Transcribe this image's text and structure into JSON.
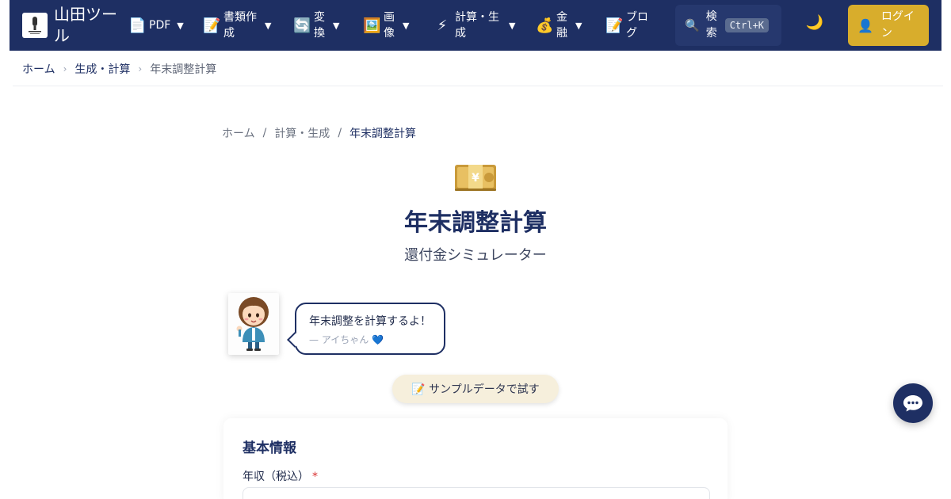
{
  "site": {
    "brand_name": "山田ツール"
  },
  "nav": {
    "items": [
      {
        "icon": "📄",
        "label": "PDF",
        "icon_name": "document-icon"
      },
      {
        "icon": "📝",
        "label": "書類作成",
        "icon_name": "memo-icon"
      },
      {
        "icon": "🔄",
        "label": "変換",
        "icon_name": "convert-icon"
      },
      {
        "icon": "🖼️",
        "label": "画像",
        "icon_name": "picture-icon"
      },
      {
        "icon": "⚡",
        "label": "計算・生成",
        "icon_name": "lightning-icon"
      },
      {
        "icon": "💰",
        "label": "金融",
        "icon_name": "money-bag-icon"
      },
      {
        "icon": "📝",
        "label": "ブログ",
        "icon_name": "memo-icon"
      }
    ],
    "search": {
      "icon": "🔍",
      "label": "検索",
      "shortcut": "Ctrl+K"
    },
    "theme_icon": "🌙",
    "login": {
      "icon": "👤",
      "label": "ログイン"
    }
  },
  "breadcrumb_top": {
    "home": "ホーム",
    "category": "生成・計算",
    "current": "年末調整計算"
  },
  "breadcrumb_inner": {
    "home": "ホーム",
    "category": "計算・生成",
    "current": "年末調整計算"
  },
  "hero": {
    "icon_name": "yen-banknote-icon",
    "title": "年末調整計算",
    "subtitle": "還付金シミュレーター"
  },
  "mascot": {
    "speech": "年末調整を計算するよ！",
    "author": "— アイちゃん 💙"
  },
  "sample_button": "📝 サンプルデータで試す",
  "form": {
    "section_title": "基本情報",
    "income_label": "年収（税込）",
    "required_mark": "*",
    "income_value": ""
  },
  "colors": {
    "navbar": "#1e2f63",
    "login_button": "#d8ad2c",
    "accent": "#1e2f63",
    "required": "#d93030"
  }
}
